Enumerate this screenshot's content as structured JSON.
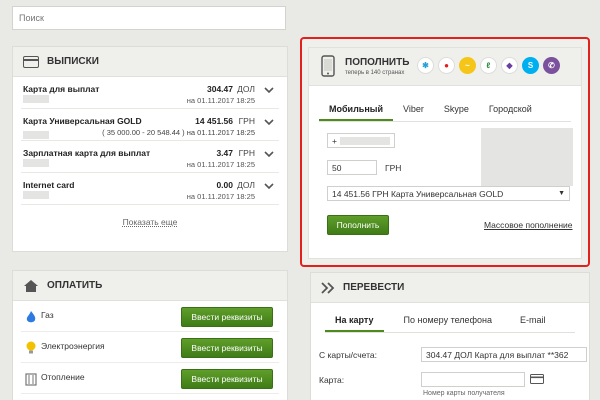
{
  "search": {
    "placeholder": "Поиск"
  },
  "statements": {
    "title": "ВЫПИСКИ",
    "rows": [
      {
        "name": "Карта для выплат",
        "amount": "304.47",
        "currency": "ДОЛ",
        "date": "на 01.11.2017 18:25"
      },
      {
        "name": "Карта Универсальная GOLD",
        "amount": "14 451.56",
        "currency": "ГРН",
        "extra": "( 35 000.00 - 20 548.44 ) на 01.11.2017 18:25"
      },
      {
        "name": "Зарплатная карта для выплат",
        "amount": "3.47",
        "currency": "ГРН",
        "date": "на 01.11.2017 18:25"
      },
      {
        "name": "Internet card",
        "amount": "0.00",
        "currency": "ДОЛ",
        "date": "на 01.11.2017 18:25"
      }
    ],
    "show_more": "Показать еще"
  },
  "topup": {
    "title": "ПОПОЛНИТЬ",
    "subtitle": "теперь в 140 странах",
    "tabs": [
      "Мобильный",
      "Viber",
      "Skype",
      "Городской"
    ],
    "phone_prefix": "+",
    "amount": "50",
    "currency": "ГРН",
    "card_select": "14 451.56 ГРН  Карта Универсальная GOLD",
    "submit": "Пополнить",
    "mass_link": "Массовое пополнение"
  },
  "pay": {
    "title": "ОПЛАТИТЬ",
    "rows": [
      {
        "label": "Газ",
        "button": "Ввести реквизиты",
        "icon": "flame-icon"
      },
      {
        "label": "Электроэнергия",
        "button": "Ввести реквизиты",
        "icon": "lightbulb-icon"
      },
      {
        "label": "Отопление",
        "button": "Ввести реквизиты",
        "icon": "radiator-icon"
      }
    ]
  },
  "transfer": {
    "title": "ПЕРЕВЕСТИ",
    "tabs": [
      "На карту",
      "По номеру телефона",
      "E-mail"
    ],
    "from_label": "С карты/счета:",
    "from_value": "304.47 ДОЛ  Карта для выплат **362",
    "card_label": "Карта:",
    "card_hint": "Номер карты получателя"
  },
  "colors": {
    "accent_green": "#4d8b1f",
    "highlight_red": "#e2211f"
  }
}
